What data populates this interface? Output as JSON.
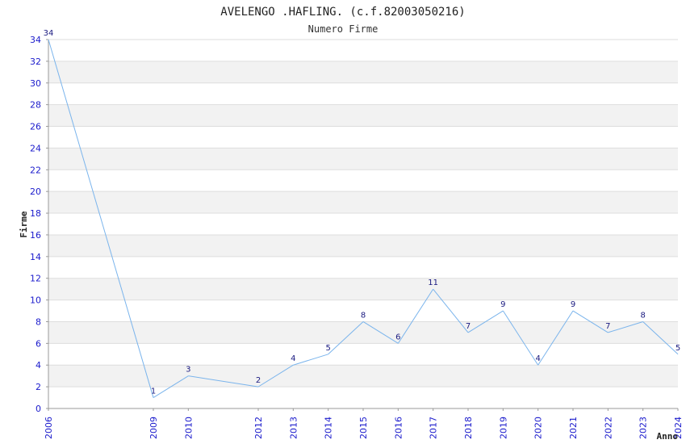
{
  "chart_data": {
    "type": "line",
    "title": "AVELENGO .HAFLING. (c.f.82003050216)",
    "subtitle": "Numero Firme",
    "xlabel": "Anno",
    "ylabel": "Firme",
    "x": [
      "2006",
      "2009",
      "2010",
      "2012",
      "2013",
      "2014",
      "2015",
      "2016",
      "2017",
      "2018",
      "2019",
      "2020",
      "2021",
      "2022",
      "2023",
      "2024"
    ],
    "series": [
      {
        "values": [
          34,
          1,
          3,
          2,
          4,
          5,
          8,
          6,
          11,
          7,
          9,
          4,
          9,
          7,
          8,
          5
        ]
      }
    ],
    "ylim": [
      0,
      34
    ],
    "yticks": [
      0,
      2,
      4,
      6,
      8,
      10,
      12,
      14,
      16,
      18,
      20,
      22,
      24,
      26,
      28,
      30,
      32,
      34
    ],
    "grid": true,
    "colors": {
      "line": "#7ab4ec",
      "band": "#f2f2f2",
      "tick": "#1a1acc",
      "label": "#1a1a80"
    }
  }
}
